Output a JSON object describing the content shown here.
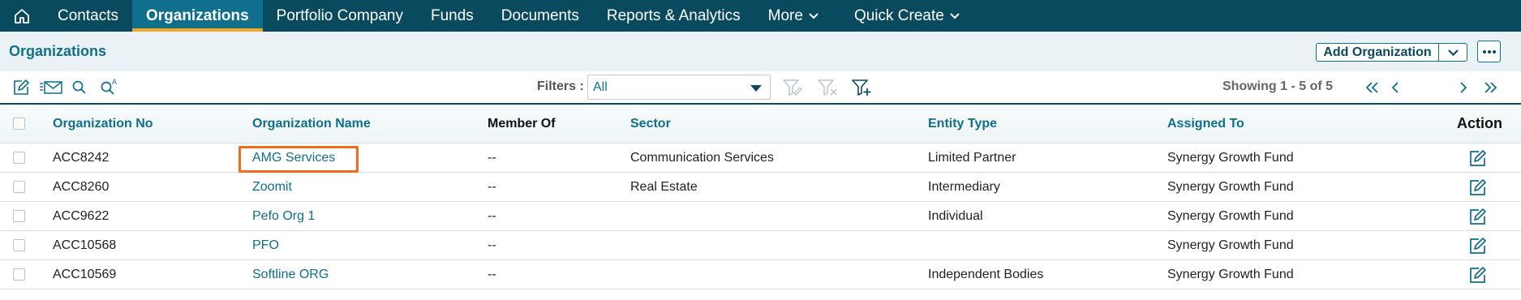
{
  "nav": {
    "items": [
      {
        "label": "Contacts"
      },
      {
        "label": "Organizations"
      },
      {
        "label": "Portfolio Company"
      },
      {
        "label": "Funds"
      },
      {
        "label": "Documents"
      },
      {
        "label": "Reports & Analytics"
      },
      {
        "label": "More"
      },
      {
        "label": "Quick Create"
      }
    ],
    "active_index": 1
  },
  "header": {
    "title": "Organizations",
    "add_button_label": "Add Organization"
  },
  "toolbar": {
    "filters_label": "Filters :",
    "filter_value": "All",
    "showing_text": "Showing 1 - 5 of 5"
  },
  "table": {
    "columns": [
      "Organization No",
      "Organization Name",
      "Member Of",
      "Sector",
      "Entity Type",
      "Assigned To",
      "Action"
    ],
    "rows": [
      {
        "no": "ACC8242",
        "name": "AMG Services",
        "member_of": "--",
        "sector": "Communication Services",
        "entity_type": "Limited Partner",
        "assigned_to": "Synergy Growth Fund"
      },
      {
        "no": "ACC8260",
        "name": "Zoomit",
        "member_of": "--",
        "sector": "Real Estate",
        "entity_type": "Intermediary",
        "assigned_to": "Synergy Growth Fund"
      },
      {
        "no": "ACC9622",
        "name": "Pefo Org 1",
        "member_of": "--",
        "sector": "",
        "entity_type": "Individual",
        "assigned_to": "Synergy Growth Fund"
      },
      {
        "no": "ACC10568",
        "name": "PFO",
        "member_of": "--",
        "sector": "",
        "entity_type": "",
        "assigned_to": "Synergy Growth Fund"
      },
      {
        "no": "ACC10569",
        "name": "Softline ORG",
        "member_of": "--",
        "sector": "",
        "entity_type": "Independent Bodies",
        "assigned_to": "Synergy Growth Fund"
      }
    ]
  },
  "colors": {
    "nav_bg": "#0a4a5e",
    "nav_active": "#0f6f8c",
    "accent": "#f5a623",
    "link": "#0f6f8c",
    "highlight": "#f26b1d"
  },
  "icons": [
    "home-icon",
    "edit-icon",
    "mass-email-icon",
    "search-icon",
    "advanced-search-icon",
    "filter-edit-icon",
    "filter-clear-icon",
    "filter-add-icon",
    "first-page-icon",
    "prev-page-icon",
    "next-page-icon",
    "last-page-icon",
    "chevron-down-icon",
    "more-options-icon",
    "edit-row-icon"
  ]
}
